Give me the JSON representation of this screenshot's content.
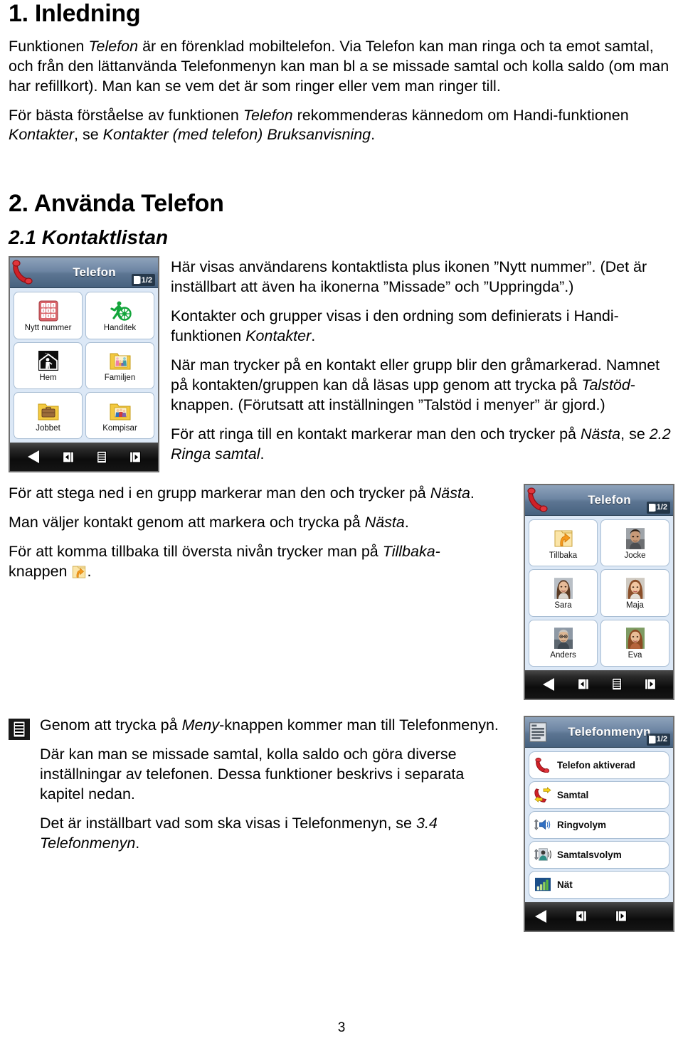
{
  "document": {
    "page_number": "3",
    "language": "sv"
  },
  "sections": {
    "intro": {
      "heading": "1. Inledning",
      "paragraphs": [
        {
          "runs": [
            {
              "t": "Funktionen ",
              "i": false
            },
            {
              "t": "Telefon",
              "i": true
            },
            {
              "t": " är en förenklad mobiltelefon. Via Telefon kan man ringa och ta emot samtal, och från den lättanvända Telefonmenyn kan man bl a se missade samtal och kolla saldo (om man har refillkort). Man kan se vem det är som ringer eller vem man ringer till.",
              "i": false
            }
          ]
        },
        {
          "runs": [
            {
              "t": "För bästa förståelse av funktionen ",
              "i": false
            },
            {
              "t": "Telefon",
              "i": true
            },
            {
              "t": " rekommenderas kännedom om Handi-funktionen ",
              "i": false
            },
            {
              "t": "Kontakter",
              "i": true
            },
            {
              "t": ", se ",
              "i": false
            },
            {
              "t": "Kontakter (med telefon) Bruksanvisning",
              "i": true
            },
            {
              "t": ".",
              "i": false
            }
          ]
        }
      ]
    },
    "use_phone": {
      "heading": "2. Använda Telefon",
      "subheading": "2.1 Kontaktlistan",
      "paragraphs_right": [
        {
          "runs": [
            {
              "t": "Här visas användarens kontaktlista plus ikonen ”Nytt nummer”. (Det är inställbart att även ha ikonerna ”Missade” och ”Uppringda”.)",
              "i": false
            }
          ]
        },
        {
          "runs": [
            {
              "t": "Kontakter och grupper visas i den ordning som definierats i Handi-funktionen ",
              "i": false
            },
            {
              "t": "Kontakter",
              "i": true
            },
            {
              "t": ".",
              "i": false
            }
          ]
        },
        {
          "runs": [
            {
              "t": "När man trycker på en kontakt eller grupp blir den gråmarkerad. Namnet på kontakten/gruppen kan då läsas upp genom att trycka på ",
              "i": false
            },
            {
              "t": "Talstöd",
              "i": true
            },
            {
              "t": "-knappen. (Förutsatt att inställningen ”Talstöd i menyer” är gjord.)",
              "i": false
            }
          ]
        },
        {
          "runs": [
            {
              "t": "För att ringa till en kontakt markerar man den och trycker på ",
              "i": false
            },
            {
              "t": "Nästa",
              "i": true
            },
            {
              "t": ", se ",
              "i": false
            },
            {
              "t": "2.2 Ringa samtal",
              "i": true
            },
            {
              "t": ".",
              "i": false
            }
          ]
        }
      ],
      "paragraphs_mid": [
        {
          "runs": [
            {
              "t": "För att stega ned i en grupp markerar man den och trycker på ",
              "i": false
            },
            {
              "t": "Nästa",
              "i": true
            },
            {
              "t": ".",
              "i": false
            }
          ]
        },
        {
          "runs": [
            {
              "t": "Man väljer kontakt genom att markera och trycka på ",
              "i": false
            },
            {
              "t": "Nästa",
              "i": true
            },
            {
              "t": ".",
              "i": false
            }
          ]
        },
        {
          "runs": [
            {
              "t": "För att komma tillbaka till översta nivån trycker man på ",
              "i": false
            },
            {
              "t": "Tillbaka-",
              "i": true
            },
            {
              "t": "\nknappen ",
              "i": false
            },
            {
              "t": "[ICON:back]",
              "i": false
            },
            {
              "t": ".",
              "i": false
            }
          ]
        }
      ],
      "paragraphs_menu": [
        {
          "runs": [
            {
              "t": "Genom att trycka på ",
              "i": false
            },
            {
              "t": "Meny",
              "i": true
            },
            {
              "t": "-knappen kommer man till Telefonmenyn.",
              "i": false
            }
          ]
        },
        {
          "runs": [
            {
              "t": "Där kan man se missade samtal, kolla saldo och göra diverse inställningar av telefonen. Dessa funktioner beskrivs i separata kapitel nedan.",
              "i": false
            }
          ]
        },
        {
          "runs": [
            {
              "t": "Det är inställbart vad som ska visas i Telefonmenyn, se ",
              "i": false
            },
            {
              "t": "3.4 Telefonmenyn",
              "i": true
            },
            {
              "t": ".",
              "i": false
            }
          ]
        }
      ]
    }
  },
  "phone_screens": [
    {
      "id": "kontaktlistan",
      "header_icon": "red-phone-handset-icon",
      "title": "Telefon",
      "page_indicator": "1/2",
      "layout": "grid",
      "tiles": [
        {
          "label": "Nytt nummer",
          "icon": "keypad-icon"
        },
        {
          "label": "Handitek",
          "icon": "handitek-wheelchair-icon"
        },
        {
          "label": "Hem",
          "icon": "home-pictogram-icon"
        },
        {
          "label": "Familjen",
          "icon": "folder-family-icon"
        },
        {
          "label": "Jobbet",
          "icon": "folder-briefcase-icon"
        },
        {
          "label": "Kompisar",
          "icon": "folder-friends-icon"
        }
      ],
      "nav": [
        "back-arrow-icon",
        "page-left-icon",
        "menu-icon",
        "page-right-icon"
      ]
    },
    {
      "id": "kontaktlista-grupp",
      "header_icon": "red-phone-handset-icon",
      "title": "Telefon",
      "page_indicator": "1/2",
      "layout": "grid",
      "tiles": [
        {
          "label": "Tillbaka",
          "icon": "back-folder-arrow-icon"
        },
        {
          "label": "Jocke",
          "icon": "contact-photo-jocke"
        },
        {
          "label": "Sara",
          "icon": "contact-photo-sara"
        },
        {
          "label": "Maja",
          "icon": "contact-photo-maja"
        },
        {
          "label": "Anders",
          "icon": "contact-photo-anders"
        },
        {
          "label": "Eva",
          "icon": "contact-photo-eva"
        }
      ],
      "nav": [
        "back-arrow-icon",
        "page-left-icon",
        "menu-icon",
        "page-right-icon"
      ]
    },
    {
      "id": "telefonmenyn",
      "header_icon": "menu-list-icon",
      "title": "Telefonmenyn",
      "page_indicator": "1/2",
      "layout": "list",
      "rows": [
        {
          "label": "Telefon aktiverad",
          "icon": "red-phone-handset-icon"
        },
        {
          "label": "Samtal",
          "icon": "call-arrows-icon"
        },
        {
          "label": "Ringvolym",
          "icon": "ring-volume-speaker-icon"
        },
        {
          "label": "Samtalsvolym",
          "icon": "call-volume-person-icon"
        },
        {
          "label": "Nät",
          "icon": "network-bars-icon"
        }
      ],
      "nav": [
        "back-arrow-icon",
        "page-left-icon",
        "page-right-icon"
      ]
    }
  ],
  "colors": {
    "header_blue": "#5c7592",
    "screen_bg": "#dce8f6",
    "tile_border": "#a9bed4",
    "nav_black": "#0c0c0c",
    "accent_red": "#c02027",
    "folder_yellow": "#f3c940",
    "handitek_green": "#13a53b",
    "back_orange": "#f59a1e"
  }
}
